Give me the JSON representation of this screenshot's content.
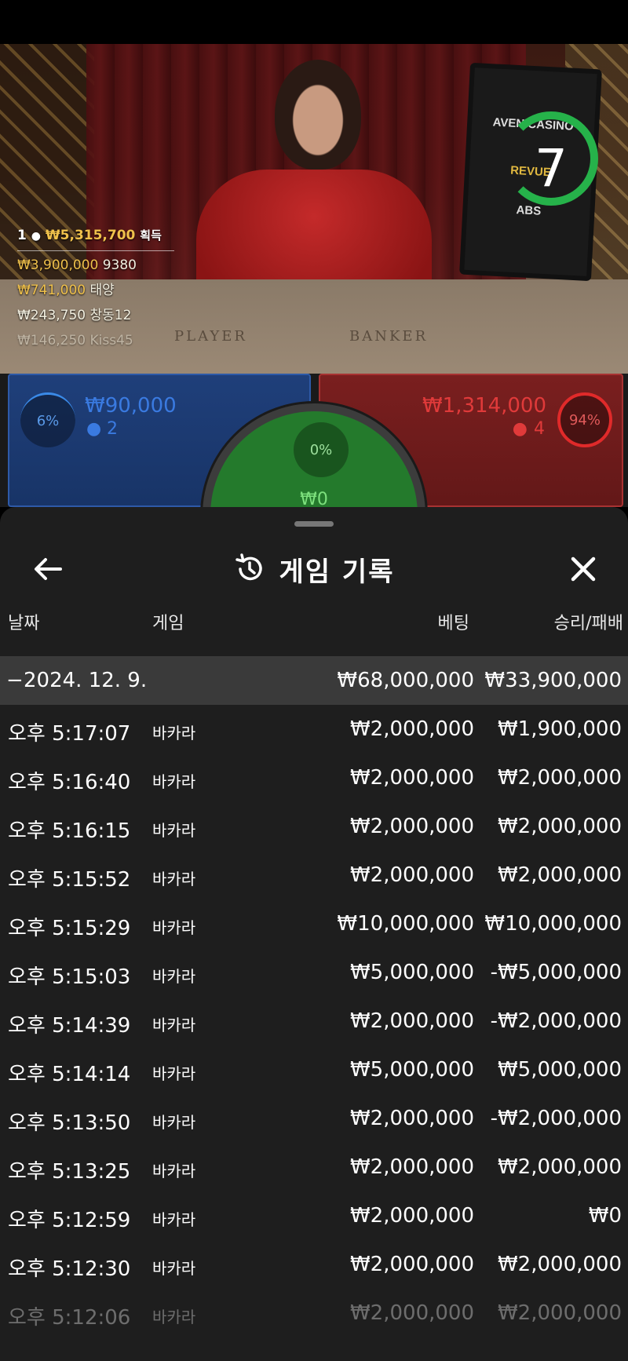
{
  "video": {
    "feed": [
      {
        "rank": "1",
        "amount": "₩5,315,700",
        "suffix": "획득"
      },
      {
        "amount": "₩3,900,000",
        "name": "9380"
      },
      {
        "amount": "₩741,000",
        "name": "태양"
      },
      {
        "amount": "₩243,750",
        "name": "창동12"
      },
      {
        "amount": "₩146,250",
        "name": "Kiss45"
      }
    ],
    "table_labels": {
      "player": "PLAYER",
      "banker": "BANKER"
    },
    "timer": "7",
    "screen_logos": [
      "AVEN CASINO",
      "REVUE",
      "ABS"
    ]
  },
  "bets": {
    "player": {
      "percent": "6%",
      "amount": "₩90,000",
      "count": "2",
      "color": "#2e5aa8"
    },
    "tie": {
      "percent": "0%",
      "amount": "₩0",
      "color": "#247a2c"
    },
    "banker": {
      "percent": "94%",
      "amount": "₩1,314,000",
      "count": "4",
      "color": "#a83232"
    }
  },
  "history": {
    "title": "게임 기록",
    "columns": {
      "date": "날짜",
      "game": "게임",
      "bet": "베팅",
      "winloss": "승리/패배"
    },
    "date_group": {
      "date": "2024. 12. 9.",
      "bet": "₩68,000,000",
      "winloss": "₩33,900,000"
    },
    "rows": [
      {
        "time": "오후 5:17:07",
        "game": "바카라",
        "bet": "₩2,000,000",
        "winloss": "₩1,900,000"
      },
      {
        "time": "오후 5:16:40",
        "game": "바카라",
        "bet": "₩2,000,000",
        "winloss": "₩2,000,000"
      },
      {
        "time": "오후 5:16:15",
        "game": "바카라",
        "bet": "₩2,000,000",
        "winloss": "₩2,000,000"
      },
      {
        "time": "오후 5:15:52",
        "game": "바카라",
        "bet": "₩2,000,000",
        "winloss": "₩2,000,000"
      },
      {
        "time": "오후 5:15:29",
        "game": "바카라",
        "bet": "₩10,000,000",
        "winloss": "₩10,000,000"
      },
      {
        "time": "오후 5:15:03",
        "game": "바카라",
        "bet": "₩5,000,000",
        "winloss": "-₩5,000,000"
      },
      {
        "time": "오후 5:14:39",
        "game": "바카라",
        "bet": "₩2,000,000",
        "winloss": "-₩2,000,000"
      },
      {
        "time": "오후 5:14:14",
        "game": "바카라",
        "bet": "₩5,000,000",
        "winloss": "₩5,000,000"
      },
      {
        "time": "오후 5:13:50",
        "game": "바카라",
        "bet": "₩2,000,000",
        "winloss": "-₩2,000,000"
      },
      {
        "time": "오후 5:13:25",
        "game": "바카라",
        "bet": "₩2,000,000",
        "winloss": "₩2,000,000"
      },
      {
        "time": "오후 5:12:59",
        "game": "바카라",
        "bet": "₩2,000,000",
        "winloss": "₩0"
      },
      {
        "time": "오후 5:12:30",
        "game": "바카라",
        "bet": "₩2,000,000",
        "winloss": "₩2,000,000"
      },
      {
        "time": "오후 5:12:06",
        "game": "바카라",
        "bet": "₩2,000,000",
        "winloss": "₩2,000,000"
      }
    ]
  }
}
